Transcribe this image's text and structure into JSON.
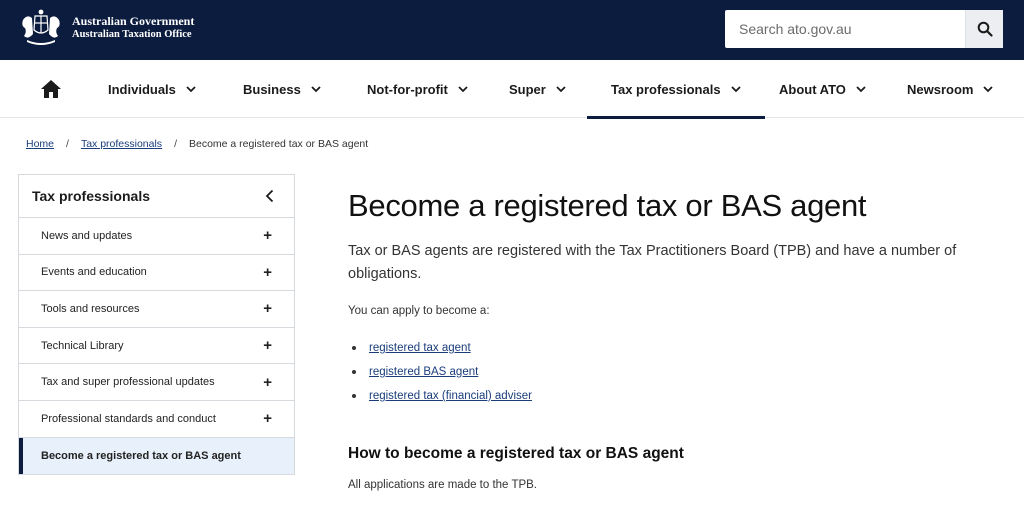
{
  "header": {
    "gov_line1": "Australian Government",
    "gov_line2": "Australian Taxation Office",
    "search_placeholder": "Search ato.gov.au"
  },
  "nav": {
    "items": [
      {
        "label": "Individuals"
      },
      {
        "label": "Business"
      },
      {
        "label": "Not-for-profit"
      },
      {
        "label": "Super"
      },
      {
        "label": "Tax professionals",
        "active": true
      },
      {
        "label": "About ATO"
      },
      {
        "label": "Newsroom"
      }
    ]
  },
  "breadcrumb": {
    "home": "Home",
    "section": "Tax professionals",
    "current": "Become a registered tax or BAS agent",
    "separator": "/"
  },
  "sidebar": {
    "title": "Tax professionals",
    "items": [
      {
        "label": "News and updates"
      },
      {
        "label": "Events and education"
      },
      {
        "label": "Tools and resources"
      },
      {
        "label": "Technical Library"
      },
      {
        "label": "Tax and super professional updates"
      },
      {
        "label": "Professional standards and conduct"
      },
      {
        "label": "Become a registered tax or BAS agent",
        "current": true
      }
    ]
  },
  "main": {
    "title": "Become a registered tax or BAS agent",
    "lead": "Tax or BAS agents are registered with the Tax Practitioners Board (TPB) and have a number of obligations.",
    "apply_text": "You can apply to become a:",
    "links": [
      "registered tax agent",
      "registered BAS agent",
      "registered tax (financial) adviser"
    ],
    "subheading": "How to become a registered tax or BAS agent",
    "body": "All applications are made to the TPB."
  },
  "colors": {
    "header_bg": "#0c1c3e",
    "link": "#1a3d7c",
    "current_item_bg": "#e8f0fb"
  },
  "icons": [
    "crest-logo-icon",
    "search-icon",
    "home-icon",
    "chevron-down-icon",
    "chevron-left-icon",
    "plus-icon"
  ]
}
